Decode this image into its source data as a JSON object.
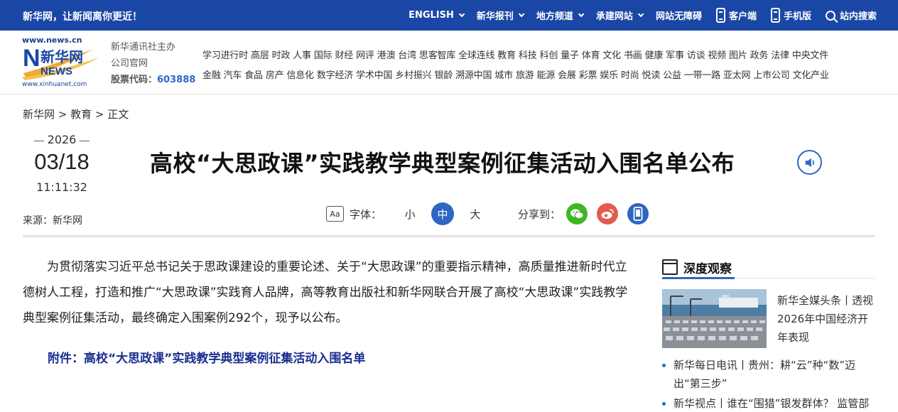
{
  "topbar": {
    "slogan": "新华网，让新闻离你更近！",
    "nav": [
      {
        "label": "ENGLISH"
      },
      {
        "label": "新华报刊"
      },
      {
        "label": "地方频道"
      },
      {
        "label": "承建网站"
      },
      {
        "label": "网站无障碍"
      },
      {
        "label": "客户端"
      },
      {
        "label": "手机版"
      },
      {
        "label": "站内搜索"
      }
    ]
  },
  "logo": {
    "url_top": "www.news.cn",
    "url_bottom": "www.xinhuanet.com",
    "brand_cn": "新华网",
    "brand_en": "NEWS"
  },
  "company": {
    "line1": "新华通讯社主办",
    "line2": "公司官网",
    "stock_label": "股票代码：",
    "stock_code": "603888"
  },
  "channels": {
    "row1": [
      "学习进行时",
      "高层",
      "时政",
      "人事",
      "国际",
      "财经",
      "网评",
      "港澳",
      "台湾",
      "思客智库",
      "全球连线",
      "教育",
      "科技",
      "科创",
      "量子",
      "体育",
      "文化",
      "书画",
      "健康",
      "军事",
      "访谈",
      "视频",
      "图片",
      "政务",
      "法律",
      "中央文件"
    ],
    "row2": [
      "金融",
      "汽车",
      "食品",
      "房产",
      "信息化",
      "数字经济",
      "学术中国",
      "乡村振兴",
      "银龄",
      "溯源中国",
      "城市",
      "旅游",
      "能源",
      "会展",
      "彩票",
      "娱乐",
      "时尚",
      "悦读",
      "公益",
      "一带一路",
      "亚太网",
      "上市公司",
      "文化产业"
    ]
  },
  "breadcrumb": "新华网 > 教育 > 正文",
  "date": {
    "year": "2026",
    "month_day": "03/18",
    "time": "11:11:32"
  },
  "source": "来源：新华网",
  "title": "高校“大思政课”实践教学典型案例征集活动入围名单公布",
  "tools": {
    "aa_icon": "Aa",
    "font_label": "字体：",
    "sizes": [
      "小",
      "中",
      "大"
    ],
    "share_label": "分享到："
  },
  "article": {
    "paragraph": "为贯彻落实习近平总书记关于思政课建设的重要论述、关于“大思政课”的重要指示精神，高质量推进新时代立德树人工程，打造和推广“大思政课”实践育人品牌，高等教育出版社和新华网联合开展了高校“大思政课”实践教学典型案例征集活动，最终确定入围案例292个，现予以公布。",
    "attachment": "附件：高校“大思政课”实践教学典型案例征集活动入围名单"
  },
  "sidebar": {
    "heading": "深度观察",
    "feature": "新华全媒头条丨透视2026年中国经济开年表现",
    "items": [
      "新华每日电讯丨贵州：耕“云”种“数”迈出“第三步”",
      "新华视点丨谁在“围猎”银发群体？ 监管部"
    ]
  },
  "colors": {
    "brand_blue": "#1a47a5",
    "accent_blue": "#2e66c2",
    "wechat_green": "#3fb624",
    "weibo_red": "#e35a4f"
  }
}
